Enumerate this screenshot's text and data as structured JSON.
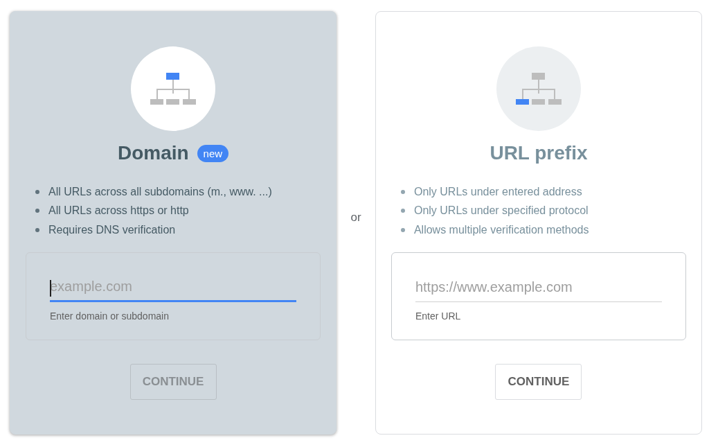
{
  "cards": [
    {
      "kind": "domain",
      "selected": true,
      "title": "Domain",
      "badge": "new",
      "bullets": [
        "All URLs across all subdomains (m., www. ...)",
        "All URLs across https or http",
        "Requires DNS verification"
      ],
      "field": {
        "placeholder": "example.com",
        "focused": true,
        "hint": "Enter domain or subdomain"
      },
      "button": {
        "label": "CONTINUE",
        "disabled": true
      }
    },
    {
      "kind": "prefix",
      "selected": false,
      "title": "URL prefix",
      "bullets": [
        "Only URLs under entered address",
        "Only URLs under specified protocol",
        "Allows multiple verification methods"
      ],
      "field": {
        "placeholder": "https://www.example.com",
        "focused": false,
        "hint": "Enter URL"
      },
      "button": {
        "label": "CONTINUE",
        "disabled": false
      }
    }
  ],
  "separator": "or"
}
